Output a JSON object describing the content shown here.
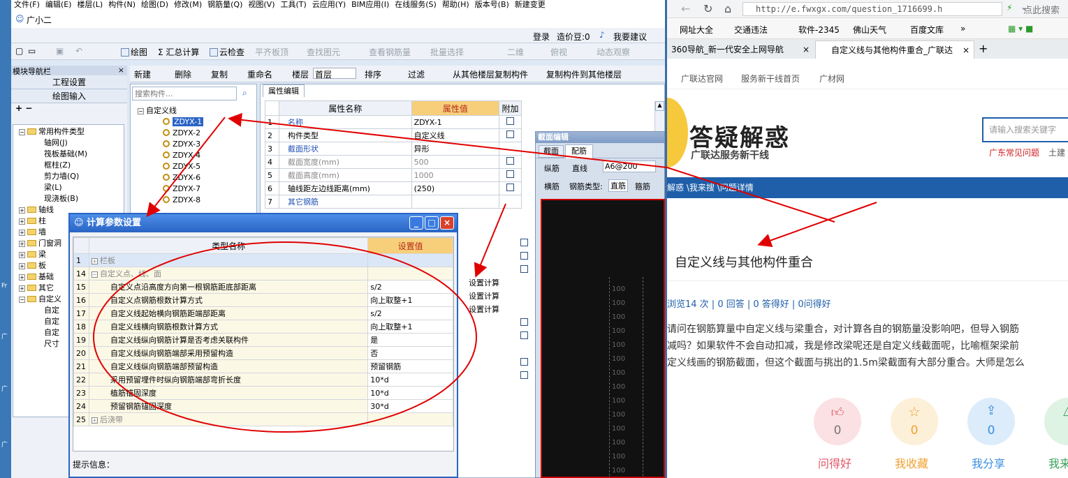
{
  "app": {
    "menu": [
      "文件(F)",
      "编辑(E)",
      "楼层(L)",
      "构件(N)",
      "绘图(D)",
      "修改(M)",
      "钢筋量(Q)",
      "视图(V)",
      "工具(T)",
      "云应用(Y)",
      "BIM应用(I)",
      "在线服务(S)",
      "帮助(H)",
      "版本号(B)",
      "新建变更"
    ],
    "assistant": "广小二",
    "login": "登录",
    "price_beans": "造价豆:0",
    "suggest": "我要建议",
    "toolbar1": [
      "绘图",
      "Σ 汇总计算",
      "云检查",
      "平齐板顶",
      "查找图元",
      "查看钢筋量",
      "批量选择",
      "二维",
      "俯视",
      "动态观察"
    ],
    "toolbar2": [
      "新建",
      "删除",
      "复制",
      "重命名",
      "楼层",
      "首层",
      "排序",
      "过滤",
      "从其他楼层复制构件",
      "复制构件到其他楼层"
    ],
    "nav": {
      "title": "模块导航栏",
      "btn1": "工程设置",
      "btn2": "绘图输入",
      "tree": [
        "常用构件类型",
        "轴网(J)",
        "筏板基础(M)",
        "框柱(Z)",
        "剪力墙(Q)",
        "梁(L)",
        "现浇板(B)",
        "轴线",
        "柱",
        "墙",
        "门窗洞",
        "梁",
        "板",
        "基础",
        "其它",
        "自定义",
        "自定",
        "自定",
        "自定",
        "尺寸"
      ]
    },
    "components": {
      "search_placeholder": "搜索构件...",
      "root": "自定义线",
      "items": [
        "ZDYX-1",
        "ZDYX-2",
        "ZDYX-3",
        "ZDYX-4",
        "ZDYX-5",
        "ZDYX-6",
        "ZDYX-7",
        "ZDYX-8"
      ]
    },
    "props": {
      "tab": "属性编辑",
      "col_name": "属性名称",
      "col_value": "属性值",
      "col_extra": "附加",
      "rows": [
        [
          "1",
          "名称",
          "ZDYX-1"
        ],
        [
          "2",
          "构件类型",
          "自定义线"
        ],
        [
          "3",
          "截面形状",
          "异形"
        ],
        [
          "4",
          "截面宽度(mm)",
          "500"
        ],
        [
          "5",
          "截面高度(mm)",
          "1000"
        ],
        [
          "6",
          "轴线距左边线距离(mm)",
          "(250)"
        ],
        [
          "7",
          "其它钢筋",
          ""
        ]
      ],
      "calc": [
        "设置计算",
        "设置计算",
        "设置计算"
      ]
    },
    "section": {
      "title": "截面编辑",
      "tabs": [
        "截面",
        "配筋"
      ],
      "zong": "纵筋",
      "line": "直线",
      "spec": "A6@200",
      "heng": "横筋",
      "type_label": "钢筋类型:",
      "zhijin": "直筋",
      "gujin": "箍筋",
      "ticks": [
        "100",
        "100",
        "100",
        "100",
        "100",
        "100",
        "100",
        "100",
        "100",
        "100",
        "100",
        "100",
        "100",
        "100"
      ]
    },
    "dialog": {
      "title": "计算参数设置",
      "col1": "类型名称",
      "col2": "设置值",
      "rows": [
        [
          "1",
          "+",
          "栏板",
          ""
        ],
        [
          "14",
          "−",
          "自定义点、线、面",
          ""
        ],
        [
          "15",
          "",
          "自定义点沿高度方向第一根钢筋距底部距离",
          "s/2"
        ],
        [
          "16",
          "",
          "自定义点钢筋根数计算方式",
          "向上取整+1"
        ],
        [
          "17",
          "",
          "自定义线起始横向钢筋距端部距离",
          "s/2"
        ],
        [
          "18",
          "",
          "自定义线横向钢筋根数计算方式",
          "向上取整+1"
        ],
        [
          "19",
          "",
          "自定义线纵向钢筋计算是否考虑关联构件",
          "是"
        ],
        [
          "20",
          "",
          "自定义线纵向钢筋端部采用预留构造",
          "否"
        ],
        [
          "21",
          "",
          "自定义线纵向钢筋端部预留构造",
          "预留钢筋"
        ],
        [
          "22",
          "",
          "采用预留埋件时纵向钢筋端部弯折长度",
          "10*d"
        ],
        [
          "23",
          "",
          "植筋锚固深度",
          "10*d"
        ],
        [
          "24",
          "",
          "预留钢筋锚固深度",
          "30*d"
        ],
        [
          "25",
          "+",
          "后浇带",
          ""
        ]
      ],
      "hint": "提示信息："
    }
  },
  "browser": {
    "url": "http://e.fwxgx.com/question_1716699.h",
    "search": "点此搜索",
    "bookmarks": [
      "网址大全",
      "交通违法",
      "软件-2345",
      "佛山天气",
      "百度文库"
    ],
    "tabs": [
      "360导航_新一代安全上网导航",
      "自定义线与其他构件重合_广联达"
    ],
    "sitelinks": [
      "广联达官网",
      "服务新干线首页",
      "广材网"
    ],
    "logo_title": "答疑解惑",
    "logo_sub": "广联达服务新干线",
    "search_placeholder": "请输入搜索关键字",
    "hot1": "广东常见问题",
    "hot2": "土建",
    "breadcrumb": "解惑 \\我来搜 \\问题详情",
    "q_title": "自定义线与其他构件重合",
    "stats": "浏览14 次 | 0 回答 | 0 答得好 | 0问得好",
    "body": [
      "请问在钢筋算量中自定义线与梁重合，对计算各自的钢筋量没影响吧，但导入钢筋",
      "减吗？如果软件不会自动扣减，我是修改梁呢还是自定义线截面呢，比喻框架梁前",
      "定义线画的钢筋截面，但这个截面与挑出的1.5m梁截面有大部分重合。大师是怎么"
    ],
    "actions": [
      {
        "label": "问得好",
        "count": "0"
      },
      {
        "label": "我收藏",
        "count": "0"
      },
      {
        "label": "我分享",
        "count": "0"
      },
      {
        "label": "我来",
        "count": ""
      }
    ]
  },
  "desktop": [
    "Fr",
    "广",
    "广",
    "广"
  ],
  "colors": {
    "accent": "#2a64c5",
    "annotation": "#e00000",
    "header_orange": "#f7cf7a",
    "browser_blue": "#1f5faa"
  }
}
